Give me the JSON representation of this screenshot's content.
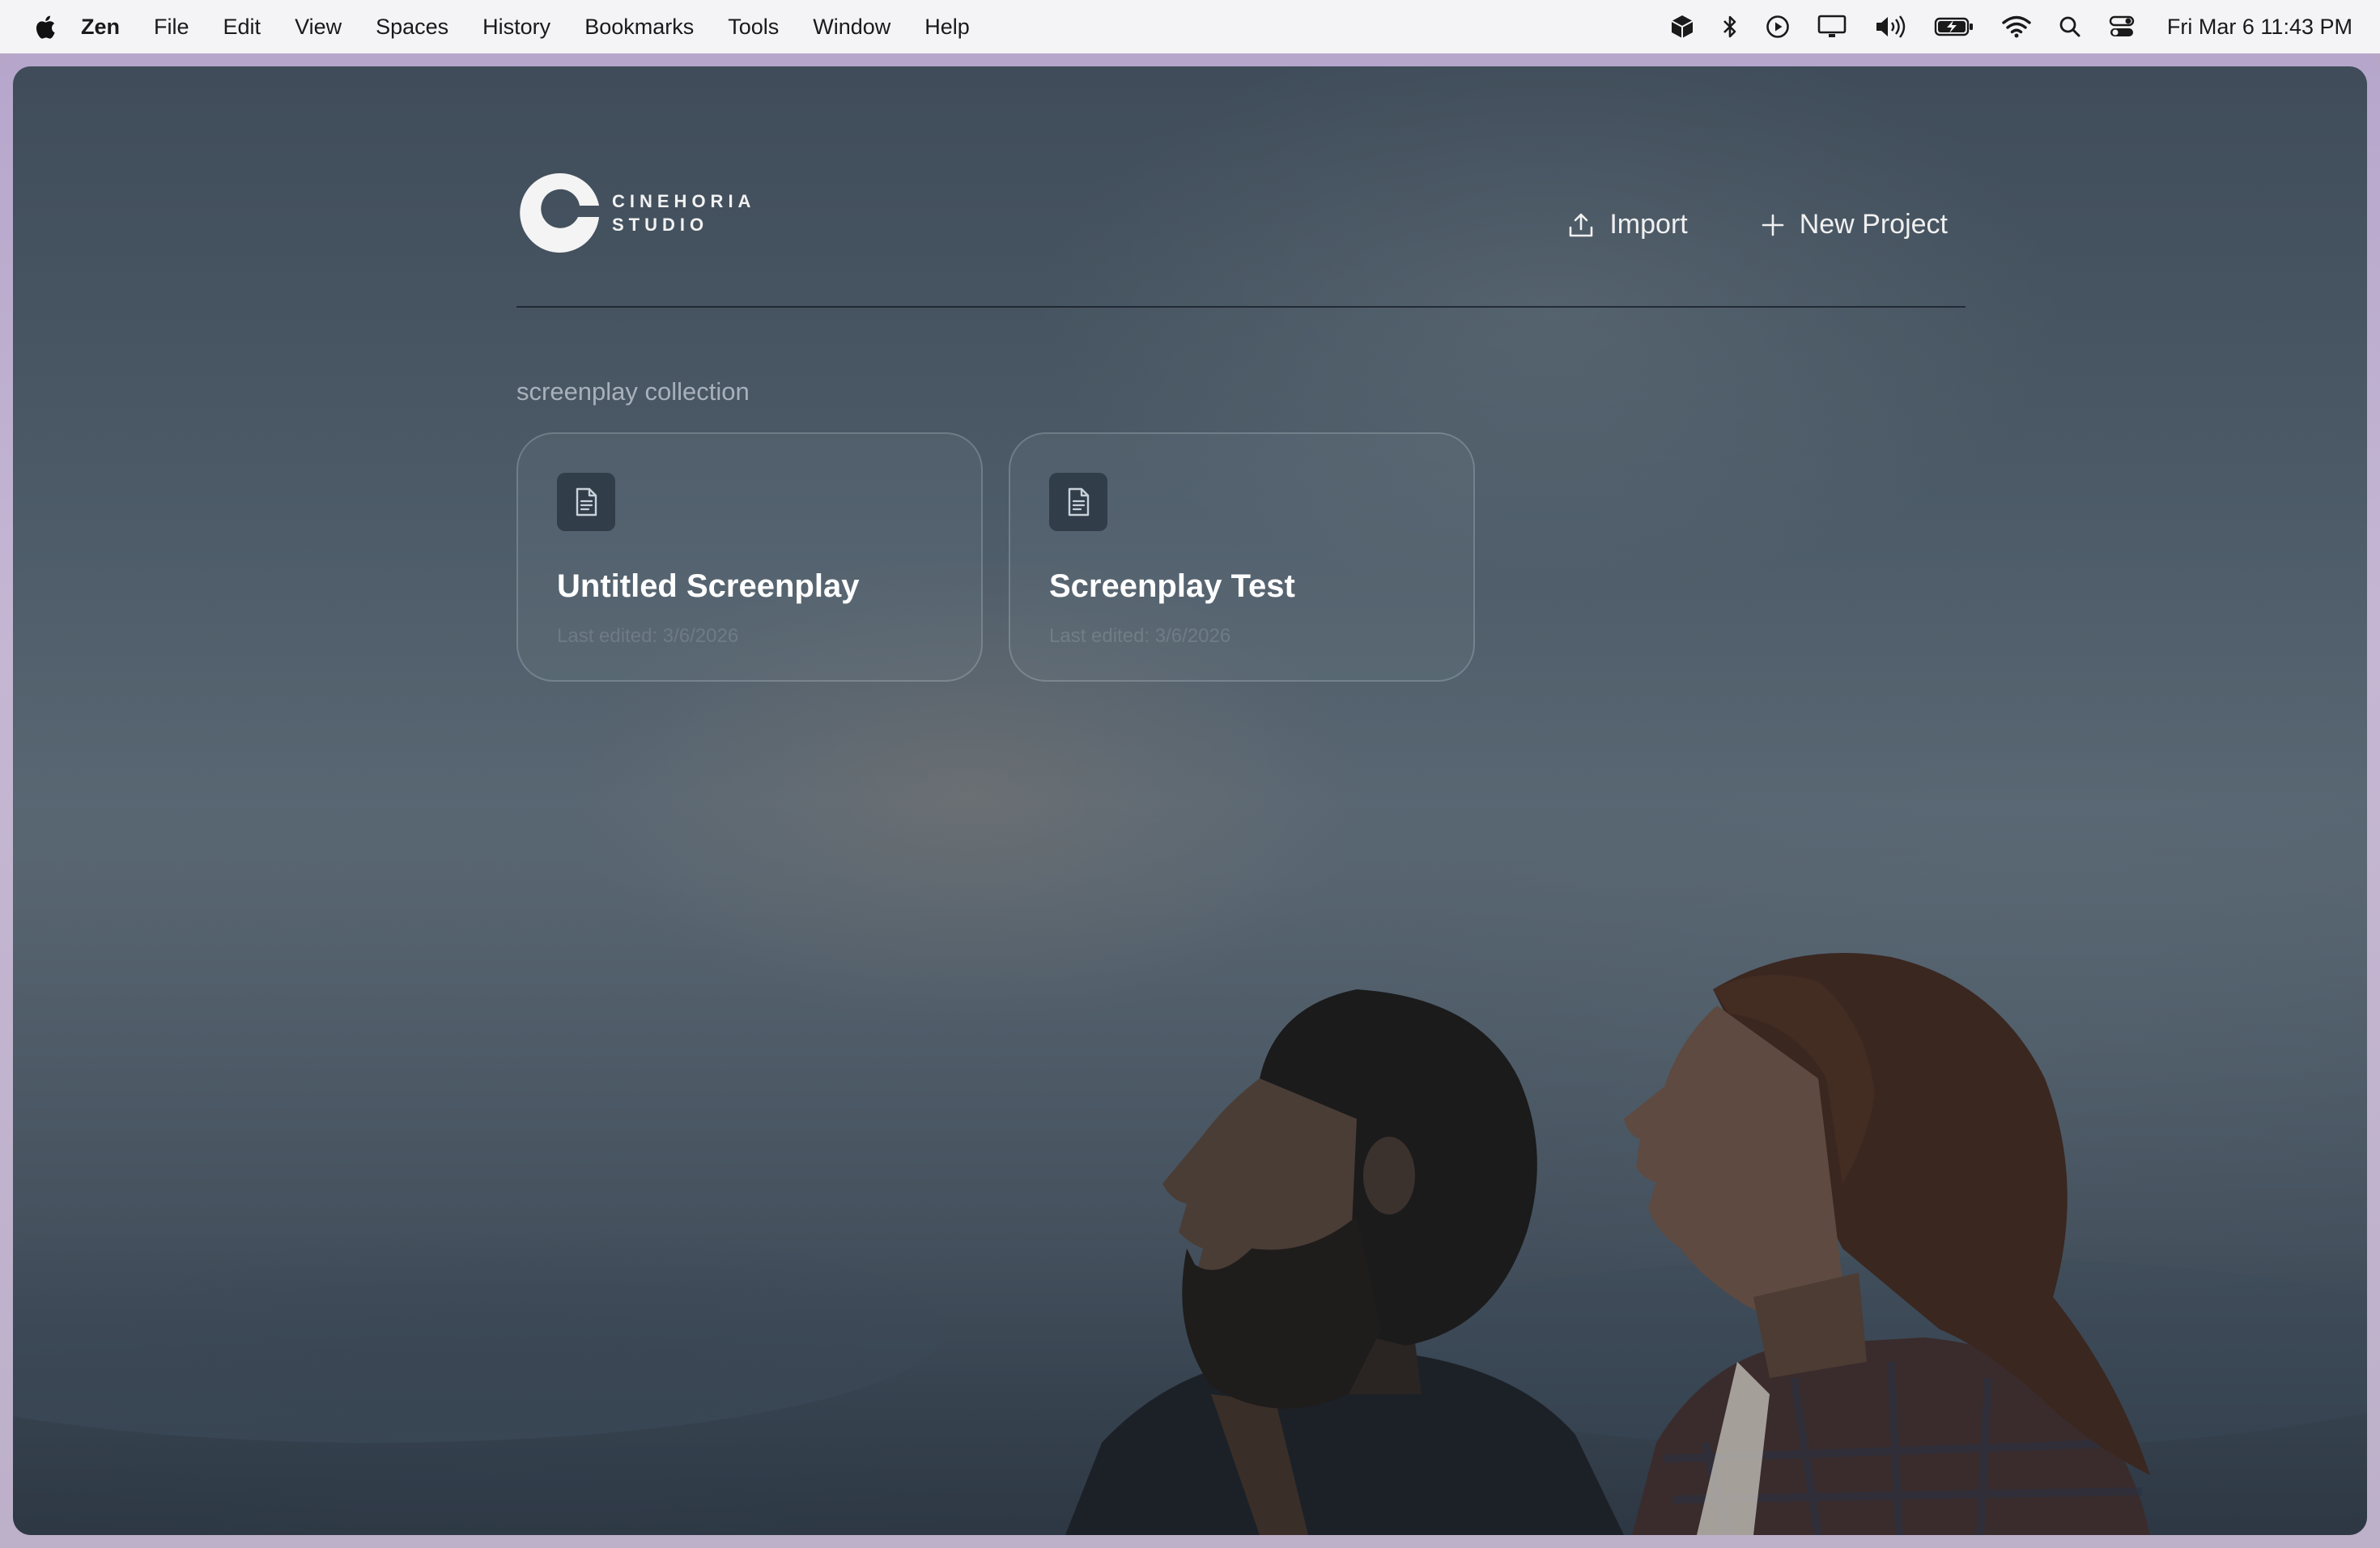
{
  "menubar": {
    "app_name": "Zen",
    "items": [
      {
        "label": "File"
      },
      {
        "label": "Edit"
      },
      {
        "label": "View"
      },
      {
        "label": "Spaces"
      },
      {
        "label": "History"
      },
      {
        "label": "Bookmarks"
      },
      {
        "label": "Tools"
      },
      {
        "label": "Window"
      },
      {
        "label": "Help"
      }
    ],
    "status_icons": [
      "cube-icon",
      "bluetooth-icon",
      "play-circle-icon",
      "display-icon",
      "volume-icon",
      "battery-charging-icon",
      "wifi-icon",
      "search-icon",
      "control-center-icon"
    ],
    "clock": "Fri Mar 6  11:43 PM"
  },
  "header": {
    "brand_line1": "CINEHORIA",
    "brand_line2": "STUDIO",
    "import_label": "Import",
    "new_project_label": "New Project"
  },
  "collection": {
    "title": "screenplay collection",
    "projects": [
      {
        "title": "Untitled Screenplay",
        "last_edited": "Last edited: 3/6/2026"
      },
      {
        "title": "Screenplay Test",
        "last_edited": "Last edited: 3/6/2026"
      }
    ]
  },
  "colors": {
    "menubar_bg": "#f4f3f6",
    "window_frame": "#b6a6cc",
    "sky_bg": "#52616e",
    "text_primary": "#ffffff"
  }
}
